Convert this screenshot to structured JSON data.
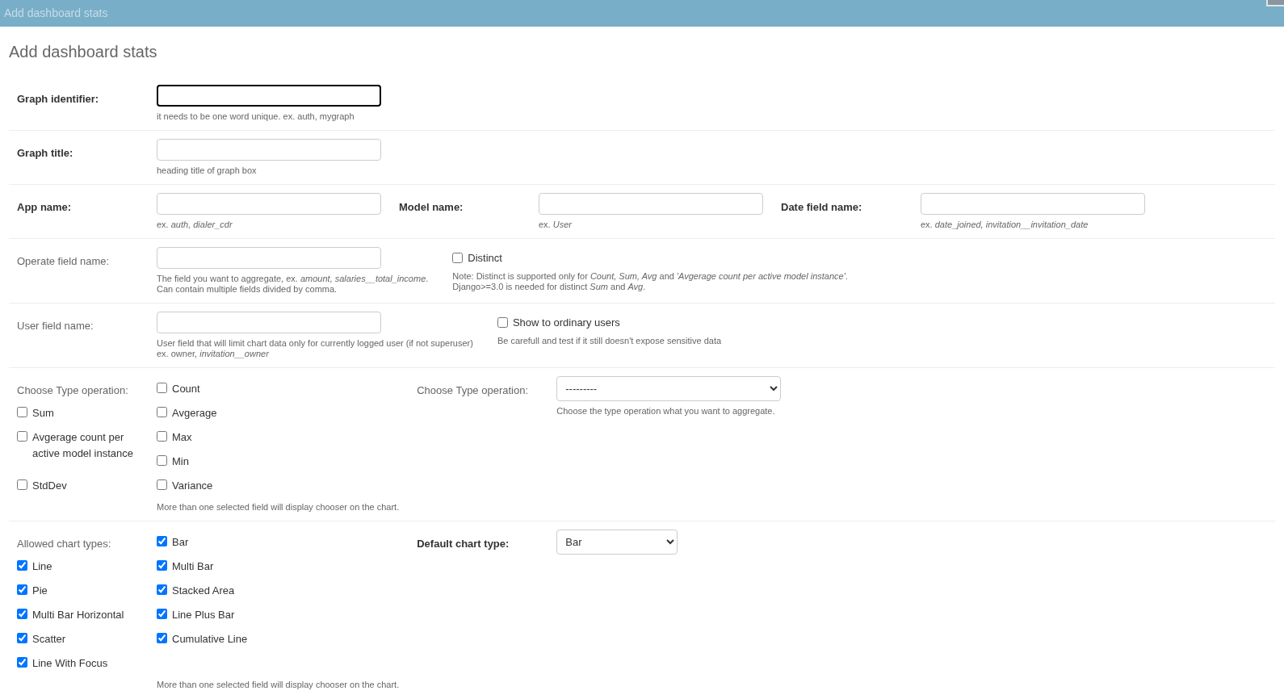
{
  "header": {
    "title": "Add dashboard stats"
  },
  "page_title": "Add dashboard stats",
  "rows": [
    {
      "fields": [
        {
          "kind": "text",
          "label": "Graph identifier:",
          "required": true,
          "focused": true,
          "help": "it needs to be one word unique. ex. auth, mygraph"
        }
      ]
    },
    {
      "fields": [
        {
          "kind": "text",
          "label": "Graph title:",
          "required": true,
          "focused": false,
          "help": "heading title of graph box"
        }
      ]
    },
    {
      "fields": [
        {
          "kind": "text",
          "label": "App name:",
          "required": true,
          "focused": false,
          "help": "ex. *auth, dialer_cdr*"
        },
        {
          "kind": "text",
          "label": "Model name:",
          "required": true,
          "focused": false,
          "help": "ex. *User*"
        },
        {
          "kind": "text",
          "label": "Date field name:",
          "required": true,
          "focused": false,
          "help": "ex. *date_joined, invitation__invitation_date*"
        }
      ]
    },
    {
      "fields": [
        {
          "kind": "text",
          "label": "Operate field name:",
          "required": false,
          "focused": false,
          "help": "The field you want to aggregate, ex. *amount, salaries__total_income*.\nCan contain multiple fields divided by comma."
        },
        {
          "kind": "checkbox",
          "label": "Distinct",
          "checked": false,
          "help": "Note: Distinct is supported only for *Count, Sum, Avg* and *'Avgerage count per active model instance'*.\nDjango>=3.0 is needed for distinct *Sum* and *Avg*."
        }
      ]
    },
    {
      "fields": [
        {
          "kind": "text",
          "label": "User field name:",
          "required": false,
          "focused": false,
          "help": "User field that will limit chart data only for currently logged user (if not superuser)\nex. owner, *invitation__owner*"
        },
        {
          "kind": "checkbox",
          "label": "Show to ordinary users",
          "checked": false,
          "help": "Be carefull and test if it still doesn't expose sensitive data"
        }
      ]
    },
    {
      "fields": [
        {
          "kind": "checkgroup",
          "label": "Choose Type operation:",
          "required": false,
          "help": "More than one selected field will display chooser on the chart.",
          "options": [
            {
              "label": "Count",
              "checked": false
            },
            {
              "label": "Sum",
              "checked": false
            },
            {
              "label": "Avgerage",
              "checked": false
            },
            {
              "label": "Avgerage count per active model instance",
              "checked": false
            },
            {
              "label": "Max",
              "checked": false
            },
            {
              "label": "Min",
              "checked": false
            },
            {
              "label": "StdDev",
              "checked": false
            },
            {
              "label": "Variance",
              "checked": false
            }
          ]
        },
        {
          "kind": "select",
          "label": "Choose Type operation:",
          "required": false,
          "value": "---------",
          "wide": true,
          "help": "Choose the type operation what you want to aggregate."
        }
      ]
    },
    {
      "fields": [
        {
          "kind": "checkgroup",
          "label": "Allowed chart types:",
          "required": false,
          "help": "More than one selected field will display chooser on the chart.",
          "options": [
            {
              "label": "Bar",
              "checked": true
            },
            {
              "label": "Line",
              "checked": true
            },
            {
              "label": "Multi Bar",
              "checked": true
            },
            {
              "label": "Pie",
              "checked": true
            },
            {
              "label": "Stacked Area",
              "checked": true
            },
            {
              "label": "Multi Bar Horizontal",
              "checked": true
            },
            {
              "label": "Line Plus Bar",
              "checked": true
            },
            {
              "label": "Scatter",
              "checked": true
            },
            {
              "label": "Cumulative Line",
              "checked": true
            },
            {
              "label": "Line With Focus",
              "checked": true
            }
          ]
        },
        {
          "kind": "select",
          "label": "Default chart type:",
          "required": true,
          "value": "Bar",
          "wide": false
        }
      ]
    }
  ]
}
